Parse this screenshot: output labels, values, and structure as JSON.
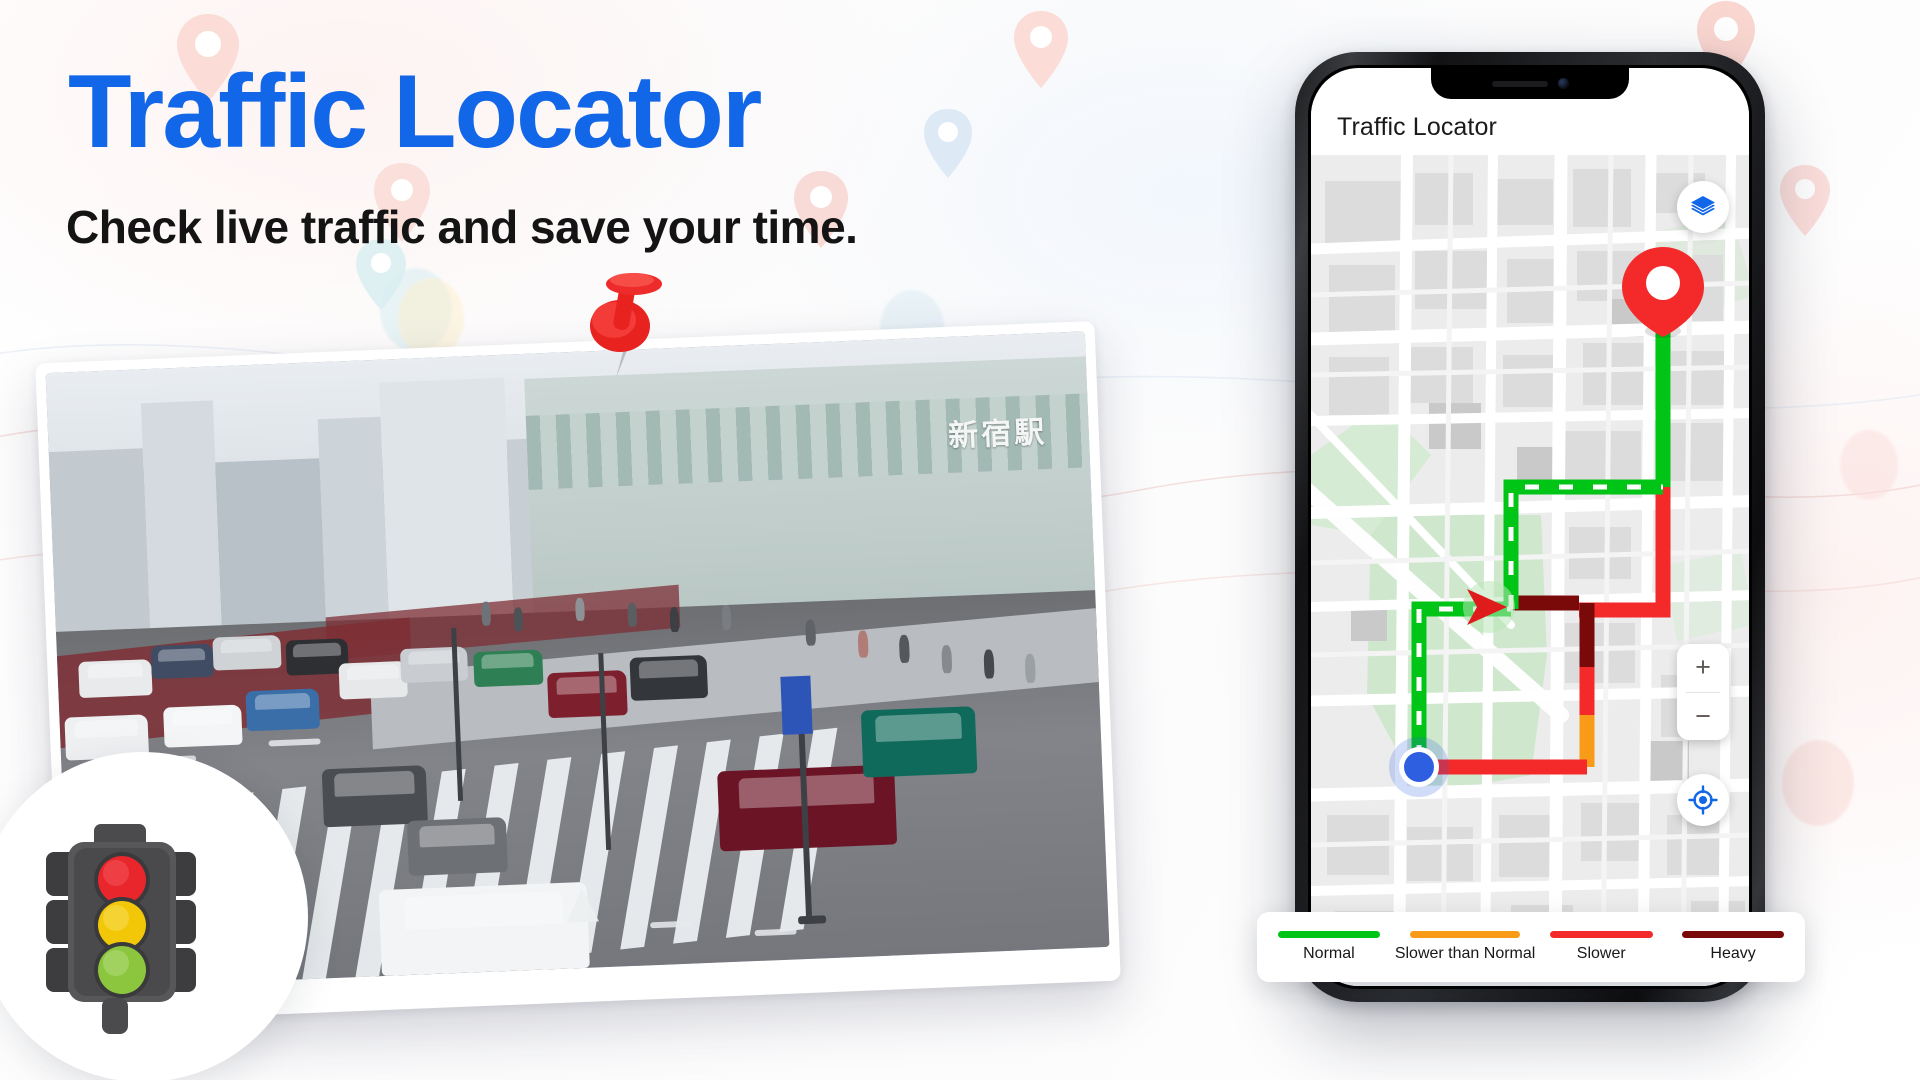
{
  "hero": {
    "title": "Traffic Locator",
    "subtitle": "Check live traffic and save your time.",
    "title_color": "#1266E8",
    "subtitle_color": "#141414"
  },
  "photo": {
    "caption_sign": "新宿駅",
    "alt": "busy city street with cars and pedestrian crossing"
  },
  "badge": {
    "icon": "traffic-light-icon",
    "lights": [
      "#E8262C",
      "#F2C707",
      "#8CC63E"
    ]
  },
  "pushpin": {
    "icon": "pushpin-icon",
    "color": "#EE2B2B"
  },
  "phone": {
    "app_title": "Traffic Locator",
    "map": {
      "layers_icon": "layers-icon",
      "zoom_in_label": "+",
      "zoom_out_label": "−",
      "locate_icon": "crosshair-locate-icon",
      "destination_pin_icon": "map-pin-icon",
      "current_location_icon": "current-location-dot",
      "heading_arrow_icon": "navigation-arrow-icon"
    }
  },
  "legend": {
    "items": [
      {
        "label": "Normal",
        "color": "#00C517"
      },
      {
        "label": "Slower than Normal",
        "color": "#F79B19"
      },
      {
        "label": "Slower",
        "color": "#F42A2A"
      },
      {
        "label": "Heavy",
        "color": "#7A0A0A"
      }
    ]
  },
  "colors": {
    "brand_blue": "#1266E8",
    "route_green": "#00C517",
    "route_orange": "#F79B19",
    "route_red": "#F42A2A",
    "route_darkred": "#7A0A0A",
    "location_blue": "#2D5FE0"
  }
}
